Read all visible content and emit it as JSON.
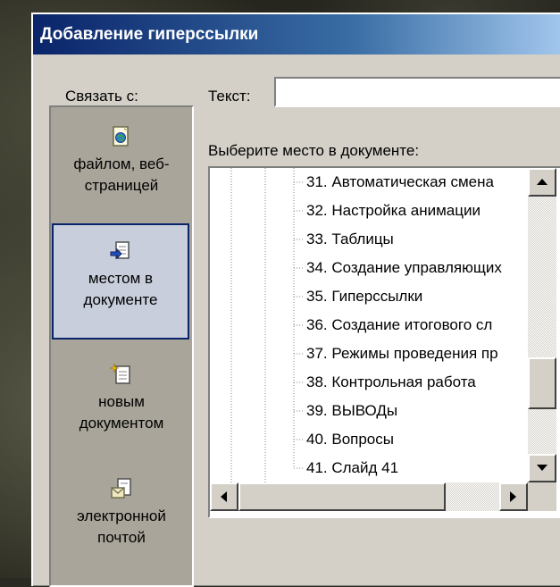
{
  "window": {
    "title": "Добавление гиперссылки"
  },
  "link_to": {
    "label": "Связать с:",
    "items": [
      {
        "label_line1": "файлом, веб-",
        "label_line2": "страницей",
        "icon": "web-page-icon",
        "selected": false
      },
      {
        "label_line1": "местом в",
        "label_line2": "документе",
        "icon": "place-in-document-icon",
        "selected": true
      },
      {
        "label_line1": "новым",
        "label_line2": "документом",
        "icon": "new-document-icon",
        "selected": false
      },
      {
        "label_line1": "электронной",
        "label_line2": "почтой",
        "icon": "email-icon",
        "selected": false
      }
    ]
  },
  "text_field": {
    "label": "Текст:",
    "value": ""
  },
  "document_place": {
    "label": "Выберите место в документе:",
    "items": [
      "31. Автоматическая смена",
      "32. Настройка анимации",
      "33. Таблицы",
      "34. Создание управляющих",
      "35. Гиперссылки",
      "36. Создание итогового сл",
      "37. Режимы проведения пр",
      "38. Контрольная  работа",
      "39. ВЫВОДы",
      "40. Вопросы",
      "41. Слайд 41"
    ]
  },
  "colors": {
    "dialog": "#d4d0c8",
    "title_start": "#0a246a",
    "title_end": "#a6caf0",
    "selected_border": "#0a246a"
  }
}
